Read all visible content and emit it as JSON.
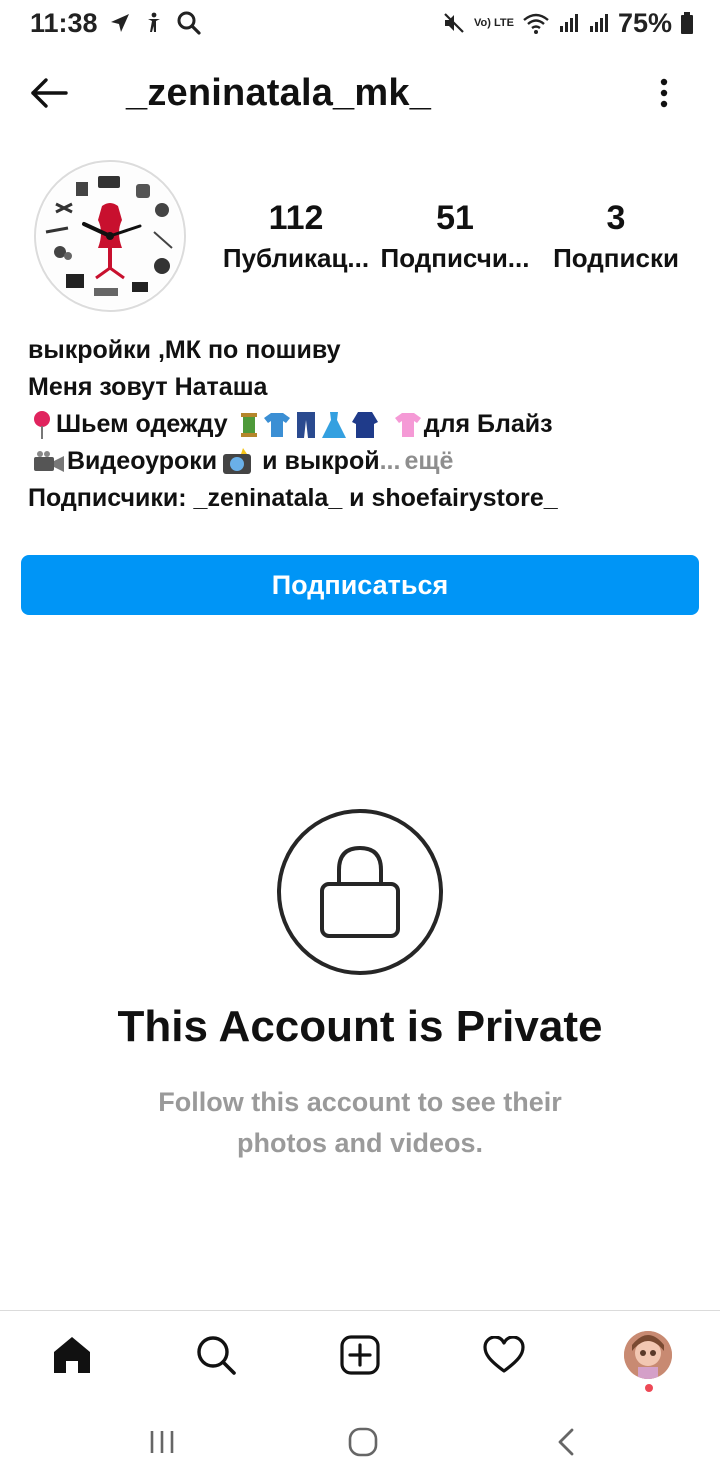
{
  "status_bar": {
    "time": "11:38",
    "battery": "75%",
    "network_label": "Vo) LTE",
    "icons": [
      "navigation-icon",
      "accessibility-icon",
      "search-icon",
      "mute-icon",
      "volte-icon",
      "wifi-icon",
      "signal-icon",
      "signal-icon",
      "battery-icon"
    ]
  },
  "header": {
    "username": "_zeninatala_mk_",
    "back_icon": "arrow-left-icon",
    "menu_icon": "more-vertical-icon"
  },
  "profile": {
    "avatar_icon": "sewing-clock-avatar",
    "stats": [
      {
        "value": "112",
        "label": "Публикац..."
      },
      {
        "value": "51",
        "label": "Подписчи..."
      },
      {
        "value": "3",
        "label": "Подписки"
      }
    ]
  },
  "bio": {
    "line1": "выкройки ,МК по пошиву",
    "line2": "Меня зовут Наташа",
    "line3_text": "Шьем одежду",
    "line3_suffix": "для Блайз",
    "line4_text": "Видеоуроки",
    "line4_suffix": "и выкрой",
    "ellipsis": "...",
    "more": "ещё",
    "followers_line": "Подписчики: _zeninatala_ и shoefairystore_"
  },
  "actions": {
    "follow_label": "Подписаться",
    "accent_color": "#0095f6"
  },
  "private_notice": {
    "icon": "lock-icon",
    "title": "This Account is Private",
    "subtitle": "Follow this account to see their photos and videos."
  },
  "tab_bar": {
    "items": [
      "home-icon",
      "search-icon",
      "add-post-icon",
      "heart-icon",
      "profile-avatar"
    ]
  },
  "system_nav": {
    "items": [
      "recents-icon",
      "home-circle-icon",
      "back-chevron-icon"
    ]
  }
}
